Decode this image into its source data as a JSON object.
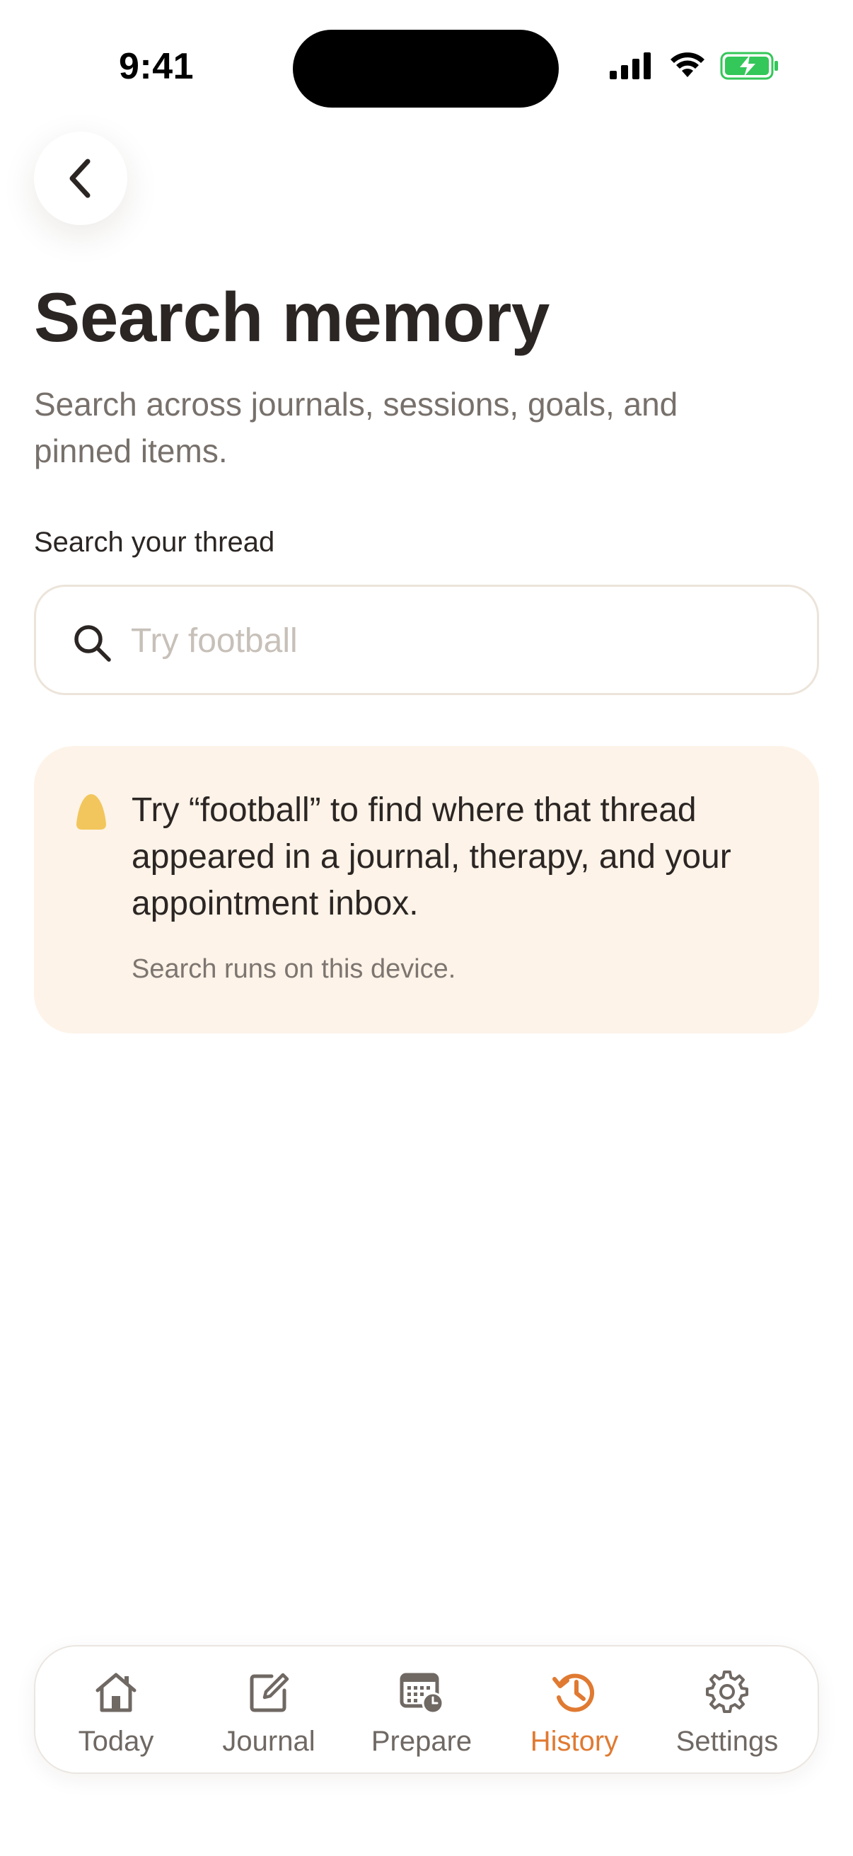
{
  "status_bar": {
    "time": "9:41",
    "icons": [
      "signal-icon",
      "wifi-icon",
      "battery-charging-icon"
    ]
  },
  "header": {
    "back_icon": "chevron-left-icon",
    "title": "Search memory",
    "subtitle": "Search across journals, sessions, goals, and pinned items."
  },
  "search": {
    "label": "Search your thread",
    "placeholder": "Try football",
    "value": "",
    "icon": "search-icon"
  },
  "hint": {
    "icon": "yellow-drop-icon",
    "text": "Try “football” to find where that thread appeared in a journal, therapy, and your appointment inbox.",
    "note": "Search runs on this device."
  },
  "tabs": [
    {
      "label": "Today",
      "icon": "home-icon",
      "active": false
    },
    {
      "label": "Journal",
      "icon": "compose-icon",
      "active": false
    },
    {
      "label": "Prepare",
      "icon": "calendar-clock-icon",
      "active": false
    },
    {
      "label": "History",
      "icon": "history-icon",
      "active": true
    },
    {
      "label": "Settings",
      "icon": "gear-icon",
      "active": false
    }
  ],
  "colors": {
    "accent": "#e07a32",
    "hint_background": "#fdf3e8",
    "hint_dot": "#f2c65c",
    "battery_green": "#34c759"
  }
}
